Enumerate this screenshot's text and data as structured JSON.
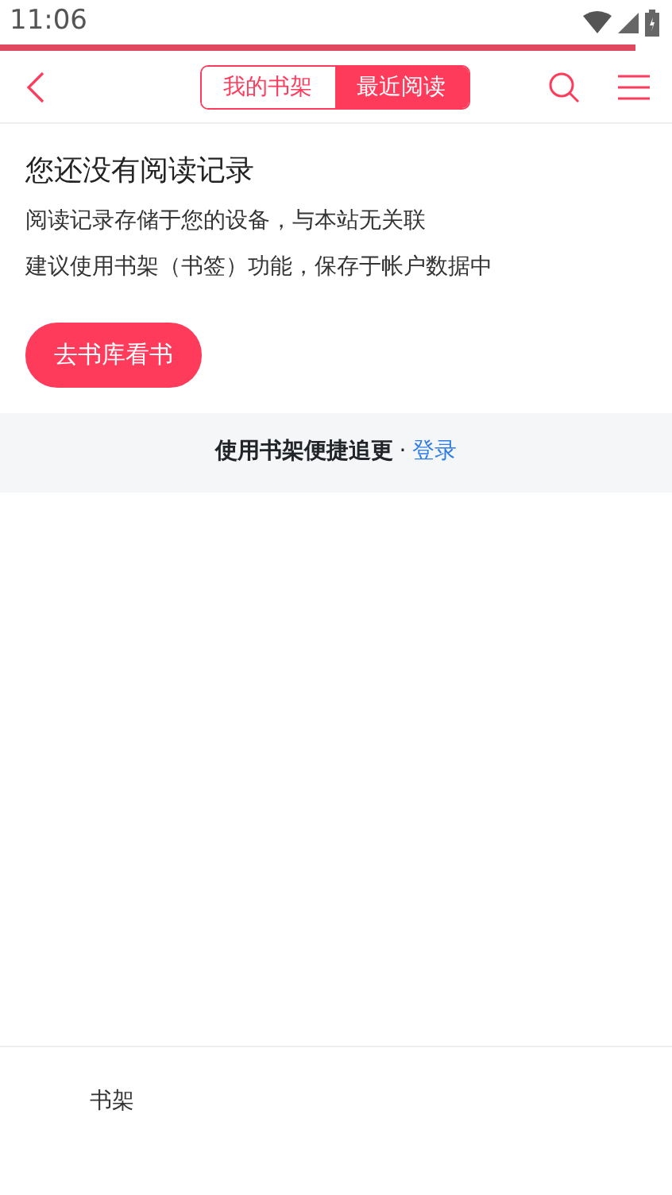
{
  "status_bar": {
    "time": "11:06"
  },
  "progress": {
    "level": 0.945
  },
  "header": {
    "tabs": [
      {
        "label": "我的书架",
        "selected": false
      },
      {
        "label": "最近阅读",
        "selected": true
      }
    ]
  },
  "empty_state": {
    "title": "您还没有阅读记录",
    "lines": [
      "阅读记录存储于您的设备，与本站无关联",
      "建议使用书架（书签）功能，保存于帐户数据中"
    ],
    "button": "去书库看书"
  },
  "notice": {
    "text": "使用书架便捷追更",
    "separator": "·",
    "link": "登录"
  },
  "bottom_nav": [
    {
      "label": "书架"
    }
  ]
}
